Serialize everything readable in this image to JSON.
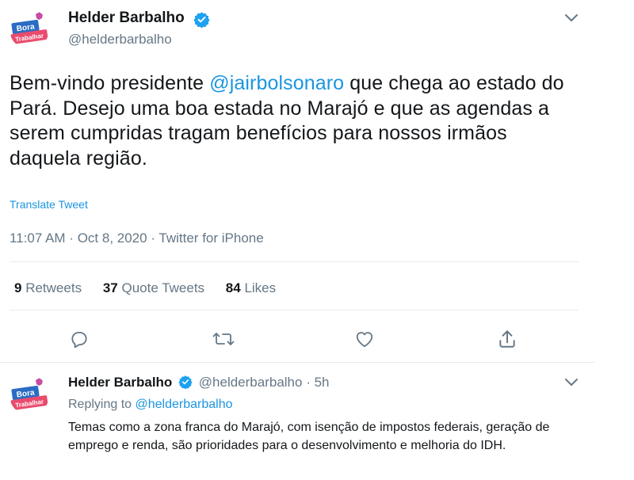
{
  "tweet": {
    "author_name": "Helder Barbalho",
    "author_handle": "@helderbarbalho",
    "text_before": "Bem-vindo presidente ",
    "mention": "@jairbolsonaro",
    "text_after": " que chega ao estado do Pará. Desejo uma boa estada no Marajó e que as agendas a serem cumpridas tragam benefícios para nossos irmãos daquela região.",
    "translate_label": "Translate Tweet",
    "time": "11:07 AM",
    "date": "Oct 8, 2020",
    "source": "Twitter for iPhone",
    "stats": {
      "retweets_count": "9",
      "retweets_label": "Retweets",
      "quotes_count": "37",
      "quotes_label": "Quote Tweets",
      "likes_count": "84",
      "likes_label": "Likes"
    }
  },
  "avatar": {
    "line1": "Bora",
    "line2": "Trabalhar"
  },
  "reply": {
    "author_name": "Helder Barbalho",
    "author_handle": "@helderbarbalho",
    "age": "5h",
    "replying_prefix": "Replying to",
    "replying_handle": "@helderbarbalho",
    "text": "Temas como a zona franca do Marajó, com isenção de impostos federais, geração de emprego e renda, são prioridades para o desenvolvimento e melhoria do IDH."
  },
  "icons": {
    "verified": "verified-badge-icon",
    "chevron": "chevron-down-icon",
    "reply": "reply-icon",
    "retweet": "retweet-icon",
    "like": "heart-icon",
    "share": "share-icon"
  },
  "colors": {
    "accent": "#1b95e0",
    "muted": "#657786",
    "text": "#14171a",
    "divider": "#e6ecf0",
    "avatar_blue": "#2b6cc4",
    "avatar_red": "#e94b6e",
    "avatar_pink": "#c94aa6"
  }
}
